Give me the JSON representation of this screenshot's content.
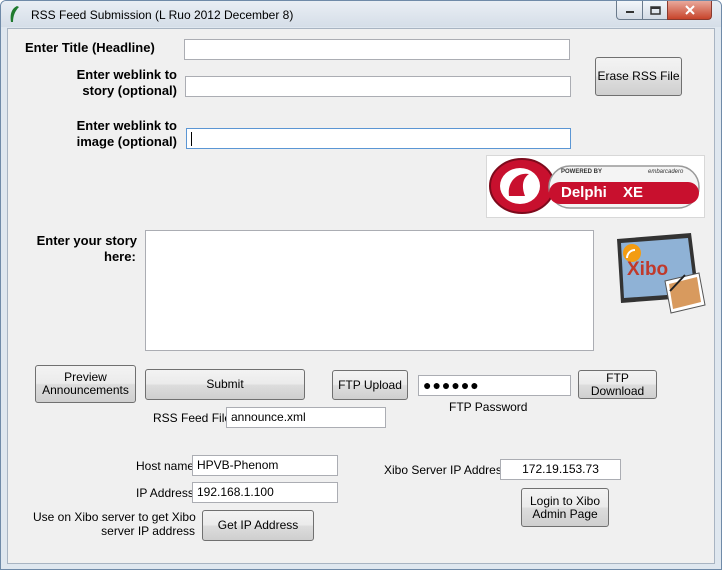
{
  "window": {
    "title": "RSS Feed Submission (L Ruo 2012 December 8)"
  },
  "form": {
    "title_label": "Enter Title (Headline)",
    "title_value": "",
    "weblink_story_label_1": "Enter weblink to",
    "weblink_story_label_2": "story (optional)",
    "weblink_story_value": "",
    "weblink_image_label_1": "Enter weblink to",
    "weblink_image_label_2": "image (optional)",
    "weblink_image_value": "",
    "story_label_1": "Enter your story",
    "story_label_2": "here:",
    "story_value": ""
  },
  "buttons": {
    "erase_rss": "Erase RSS File",
    "preview_1": "Preview",
    "preview_2": "Announcements",
    "submit": "Submit",
    "ftp_upload": "FTP Upload",
    "ftp_download": "FTP Download",
    "get_ip": "Get IP Address",
    "login_xibo_1": "Login to Xibo",
    "login_xibo_2": "Admin Page"
  },
  "ftp": {
    "password_masked": "●●●●●●",
    "password_label": "FTP Password"
  },
  "rss": {
    "file_label": "RSS Feed File",
    "file_value": "announce.xml"
  },
  "network": {
    "host_label": "Host name",
    "host_value": "HPVB-Phenom",
    "ip_label": "IP Address",
    "ip_value": "192.168.1.100",
    "xibo_hint_1": "Use on Xibo server to get Xibo",
    "xibo_hint_2": "server IP address",
    "xibo_server_label": "Xibo Server IP Address",
    "xibo_server_value": "172.19.153.73"
  },
  "logos": {
    "delphi_powered_by": "POWERED BY",
    "delphi_vendor": "embarcadero",
    "delphi_name": "Delphi",
    "delphi_version": "XE",
    "xibo_name": "Xibo"
  },
  "colors": {
    "titlebar": "#dfe7ef",
    "client": "#f0f0f0",
    "close": "#c7442b",
    "delphi_red": "#c8102e"
  }
}
